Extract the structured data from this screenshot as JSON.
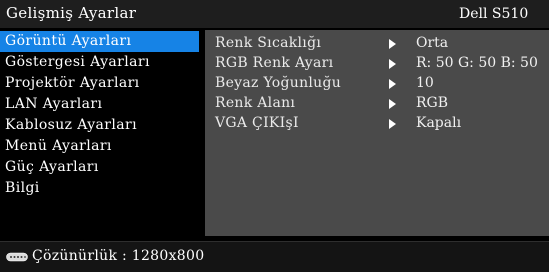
{
  "header": {
    "title": "Gelişmiş Ayarlar",
    "brand": "Dell S510"
  },
  "menu": {
    "items": [
      {
        "label": "Görüntü Ayarları",
        "active": true
      },
      {
        "label": "Göstergesi Ayarları",
        "active": false
      },
      {
        "label": "Projektör Ayarları",
        "active": false
      },
      {
        "label": "LAN Ayarları",
        "active": false
      },
      {
        "label": "Kablosuz Ayarları",
        "active": false
      },
      {
        "label": "Menü Ayarları",
        "active": false
      },
      {
        "label": "Güç Ayarları",
        "active": false
      },
      {
        "label": "Bilgi",
        "active": false
      }
    ]
  },
  "panel": {
    "rows": [
      {
        "label": "Renk Sıcaklığı",
        "value": "Orta"
      },
      {
        "label": "RGB Renk Ayarı",
        "value": "R: 50  G: 50  B: 50"
      },
      {
        "label": "Beyaz Yoğunluğu",
        "value": "10"
      },
      {
        "label": "Renk Alanı",
        "value": "RGB"
      },
      {
        "label": "VGA ÇIKIşI",
        "value": "Kapalı"
      }
    ]
  },
  "status": {
    "icon": "connector-icon",
    "text": "Çözünürlük : 1280x800"
  },
  "colors": {
    "highlight": "#1683e6",
    "panel": "#4a4a4a",
    "background": "#000000"
  }
}
